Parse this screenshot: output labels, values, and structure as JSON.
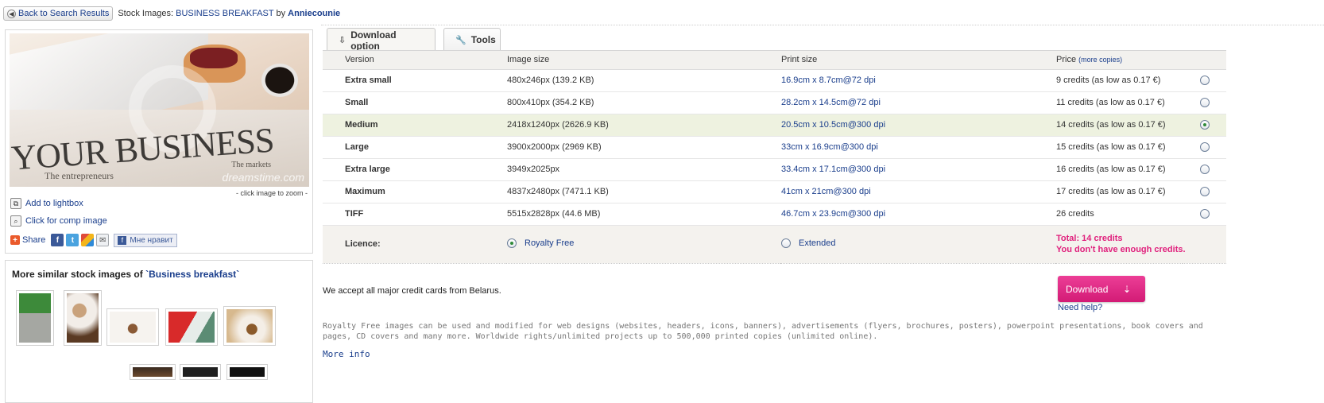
{
  "topbar": {
    "back_label": "Back to Search Results",
    "prefix": "Stock Images:",
    "image_title": "BUSINESS BREAKFAST",
    "by": "by",
    "author": "Anniecounie"
  },
  "image_panel": {
    "headline": "YOUR BUSINESS",
    "subline": "The entrepreneurs",
    "markets": "The markets",
    "watermark": "dreamstime.com",
    "zoom_hint": "- click image to zoom -",
    "actions": [
      {
        "label": "Add to lightbox",
        "icon": "lightbox-icon"
      },
      {
        "label": "Click for comp image",
        "icon": "magnifier-icon"
      }
    ],
    "share_label": "Share",
    "like_label": "Мне нравит"
  },
  "similar": {
    "title_prefix": "More similar stock images of",
    "query": "`Business breakfast`"
  },
  "tabs": [
    {
      "label": "Download option",
      "icon": "download-icon"
    },
    {
      "label": "Tools",
      "icon": "wrench-icon"
    }
  ],
  "table": {
    "headers": {
      "version": "Version",
      "image_size": "Image size",
      "print_size": "Print size",
      "price": "Price",
      "more_copies": "(more copies)"
    },
    "rows": [
      {
        "version": "Extra small",
        "image_size": "480x246px (139.2 KB)",
        "print_size": "16.9cm x 8.7cm@72 dpi",
        "price": "9 credits (as low as 0.17 €)",
        "selected": false
      },
      {
        "version": "Small",
        "image_size": "800x410px (354.2 KB)",
        "print_size": "28.2cm x 14.5cm@72 dpi",
        "price": "11 credits (as low as 0.17 €)",
        "selected": false
      },
      {
        "version": "Medium",
        "image_size": "2418x1240px (2626.9 KB)",
        "print_size": "20.5cm x 10.5cm@300 dpi",
        "price": "14 credits (as low as 0.17 €)",
        "selected": true
      },
      {
        "version": "Large",
        "image_size": "3900x2000px (2969 KB)",
        "print_size": "33cm x 16.9cm@300 dpi",
        "price": "15 credits (as low as 0.17 €)",
        "selected": false
      },
      {
        "version": "Extra large",
        "image_size": "3949x2025px",
        "print_size": "33.4cm x 17.1cm@300 dpi",
        "price": "16 credits (as low as 0.17 €)",
        "selected": false
      },
      {
        "version": "Maximum",
        "image_size": "4837x2480px (7471.1 KB)",
        "print_size": "41cm x 21cm@300 dpi",
        "price": "17 credits (as low as 0.17 €)",
        "selected": false
      },
      {
        "version": "TIFF",
        "image_size": "5515x2828px (44.6 MB)",
        "print_size": "46.7cm x 23.9cm@300 dpi",
        "price": "26 credits",
        "selected": false
      }
    ],
    "licence": {
      "label": "Licence:",
      "royalty_free": "Royalty Free",
      "extended": "Extended",
      "selected": "royalty_free",
      "total": "Total: 14 credits",
      "not_enough": "You don't have enough credits."
    }
  },
  "bottom": {
    "cards_note": "We accept all major credit cards from Belarus.",
    "download_label": "Download",
    "need_help": "Need help?",
    "rf_note": "Royalty Free images can be used and modified for web designs (websites, headers, icons, banners), advertisements (flyers, brochures, posters), powerpoint presentations, book covers and pages, CD covers and many more. Worldwide rights/unlimited projects up to 500,000 printed copies (unlimited online).",
    "more_info": "More info"
  },
  "colors": {
    "accent_link": "#1a3e8c",
    "download_pink": "#e0217d",
    "selected_row": "#eef2e0"
  }
}
